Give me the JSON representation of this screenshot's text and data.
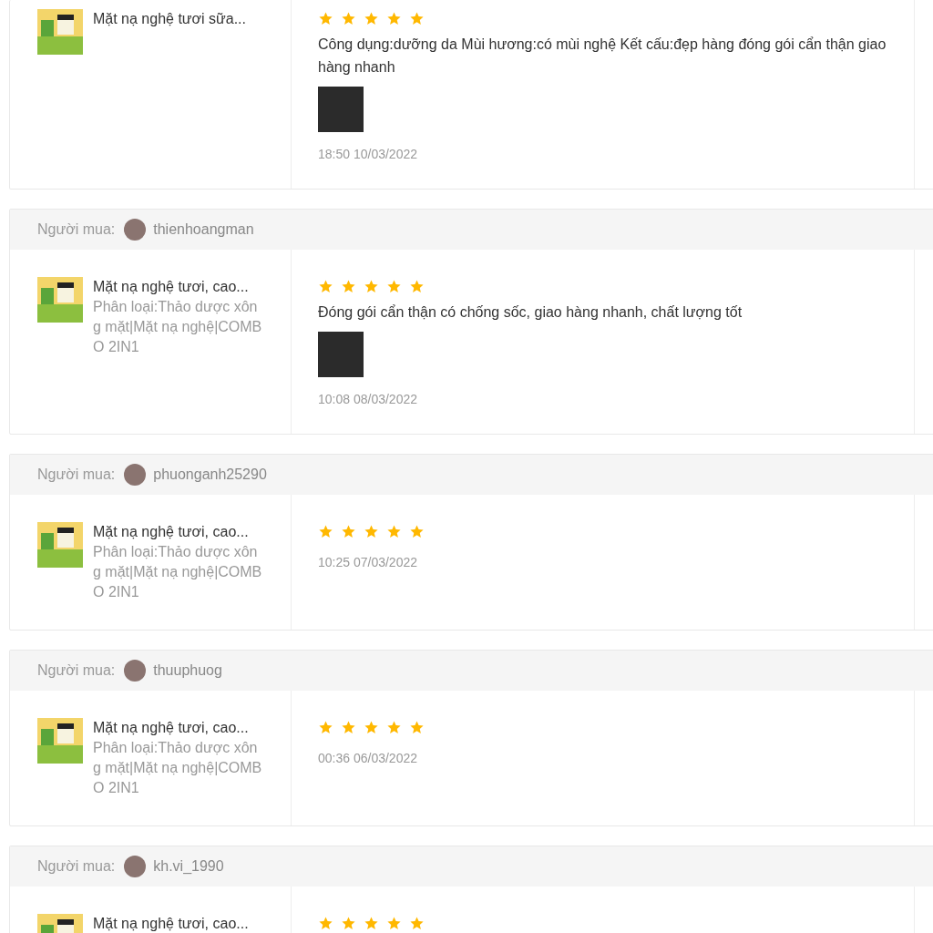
{
  "reviews": [
    {
      "product_name": "Mặt nạ nghệ tươi sữa...",
      "stars": 5,
      "comment": "Công dụng:dưỡng da Mùi hương:có mùi nghệ Kết cấu:đẹp hàng đóng gói cẩn thận giao hàng nhanh",
      "has_photo": true,
      "time": "18:50 10/03/2022"
    },
    {
      "buyer_label": "Người mua:",
      "username": "thienhoangman",
      "product_name": "Mặt nạ nghệ tươi, cao...",
      "variation": "Phân loại:Thảo dược xông mặt|Mặt nạ nghệ|COMBO 2IN1",
      "stars": 5,
      "comment": "Đóng gói cẩn thận có chống sốc, giao hàng nhanh, chất lượng tốt",
      "has_photo": true,
      "time": "10:08 08/03/2022"
    },
    {
      "buyer_label": "Người mua:",
      "username": "phuonganh25290",
      "product_name": "Mặt nạ nghệ tươi, cao...",
      "variation": "Phân loại:Thảo dược xông mặt|Mặt nạ nghệ|COMBO 2IN1",
      "stars": 5,
      "has_photo": false,
      "time": "10:25 07/03/2022"
    },
    {
      "buyer_label": "Người mua:",
      "username": "thuuphuog",
      "product_name": "Mặt nạ nghệ tươi, cao...",
      "variation": "Phân loại:Thảo dược xông mặt|Mặt nạ nghệ|COMBO 2IN1",
      "stars": 5,
      "has_photo": false,
      "time": "00:36 06/03/2022"
    },
    {
      "buyer_label": "Người mua:",
      "username": "kh.vi_1990",
      "product_name": "Mặt nạ nghệ tươi, cao...",
      "stars": 5,
      "has_photo": false
    }
  ]
}
